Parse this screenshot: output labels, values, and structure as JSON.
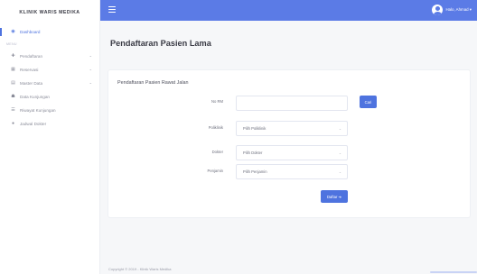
{
  "brand": {
    "name": "KLINIK WARIS MEDIKA"
  },
  "sidebar": {
    "items": [
      {
        "label": "Dashboard",
        "icon": "tachometer-icon",
        "active": true,
        "chevron": false
      },
      {
        "label": "Pendaftaran",
        "icon": "user-plus-icon",
        "active": false,
        "chevron": true
      },
      {
        "label": "Reservasi",
        "icon": "calendar-icon",
        "active": false,
        "chevron": true
      },
      {
        "label": "Master Data",
        "icon": "database-icon",
        "active": false,
        "chevron": true
      },
      {
        "label": "Data Kunjungan",
        "icon": "users-icon",
        "active": false,
        "chevron": false
      },
      {
        "label": "Riwayat Kunjungan",
        "icon": "list-icon",
        "active": false,
        "chevron": false
      },
      {
        "label": "Jadwal Dokter",
        "icon": "clock-icon",
        "active": false,
        "chevron": false
      }
    ],
    "section_heading": "MENU"
  },
  "topbar": {
    "user_label": "Halo, Ahmad ▾",
    "accent": "#5b7be6"
  },
  "page": {
    "title": "Pendaftaran Pasien Lama"
  },
  "form": {
    "card_title": "Pendaftaran Pasien Rawat Jalan",
    "no_rm": {
      "label": "No RM",
      "value": "",
      "placeholder": ""
    },
    "cari_button": "Cari",
    "poliklinik": {
      "label": "Poliklinik",
      "selected": "Pilih Poliklinik"
    },
    "dokter": {
      "label": "Dokter",
      "selected": "Pilih Dokter"
    },
    "penjamin": {
      "label": "Penjamin",
      "selected": "Pilih Penjamin"
    },
    "submit_button": "Daftar ➔"
  },
  "footer": {
    "copyright": "Copyright © 2019 - Klinik Waris Medika"
  }
}
